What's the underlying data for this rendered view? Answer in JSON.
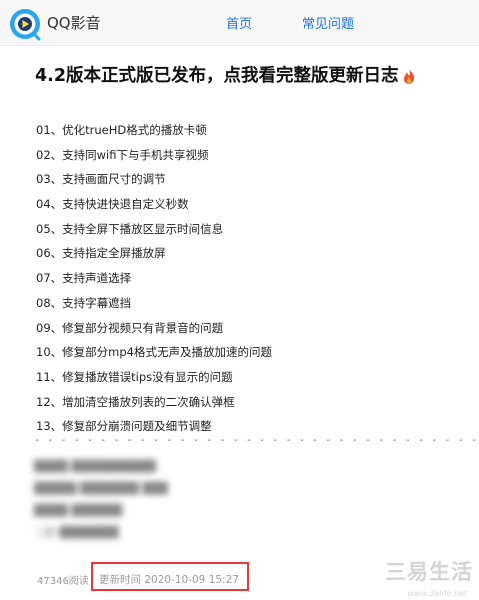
{
  "header": {
    "brand": "QQ影音",
    "nav": {
      "home": "首页",
      "faq": "常见问题"
    }
  },
  "article": {
    "headline": "4.2版本正式版已发布，点我看完整版更新日志",
    "changelog": [
      "01、优化trueHD格式的播放卡顿",
      "02、支持同wifi下与手机共享视频",
      "03、支持画面尺寸的调节",
      "04、支持快进快退自定义秒数",
      "05、支持全屏下播放区显示时间信息",
      "06、支持指定全屏播放屏",
      "07、支持声道选择",
      "08、支持字幕遮挡",
      "09、修复部分视频只有背景音的问题",
      "10、修复部分mp4格式无声及播放加速的问题",
      "11、修复播放错误tips没有显示的问题",
      "12、增加清空播放列表的二次确认弹框",
      "13、修复部分崩溃问题及细节调整"
    ],
    "separator": "- - - - - - - - - - - - - - - - - - - - - - - - - - - - - - - - - - - - - - - - - - - - - - - - - - - - -",
    "blurred_lines": [
      "████ ██████████",
      "█████ ███████ ███",
      "████ ██████",
      "二群 ███████"
    ],
    "read_count": "47346阅读",
    "update_time": "更新时间 2020-10-09 15:27"
  },
  "watermark": {
    "text": "三易生活",
    "url": "www.3elife.net"
  }
}
